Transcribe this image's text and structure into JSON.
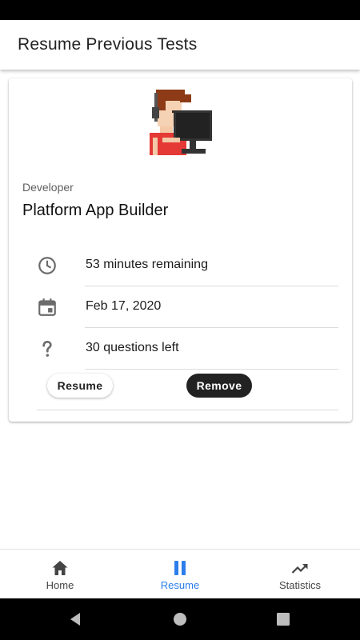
{
  "app_bar": {
    "title": "Resume Previous Tests"
  },
  "card": {
    "category": "Developer",
    "test_name": "Platform App Builder",
    "time_remaining": "53 minutes remaining",
    "date": "Feb 17, 2020",
    "questions_left": "30 questions left",
    "resume_label": "Resume",
    "remove_label": "Remove"
  },
  "bottom_nav": {
    "items": [
      {
        "label": "Home",
        "icon": "home-icon"
      },
      {
        "label": "Resume",
        "icon": "pause-icon",
        "active": true
      },
      {
        "label": "Statistics",
        "icon": "trending-up-icon"
      }
    ]
  },
  "colors": {
    "accent": "#2b7de9",
    "remove_button": "#222222",
    "status_bar": "#000000"
  }
}
